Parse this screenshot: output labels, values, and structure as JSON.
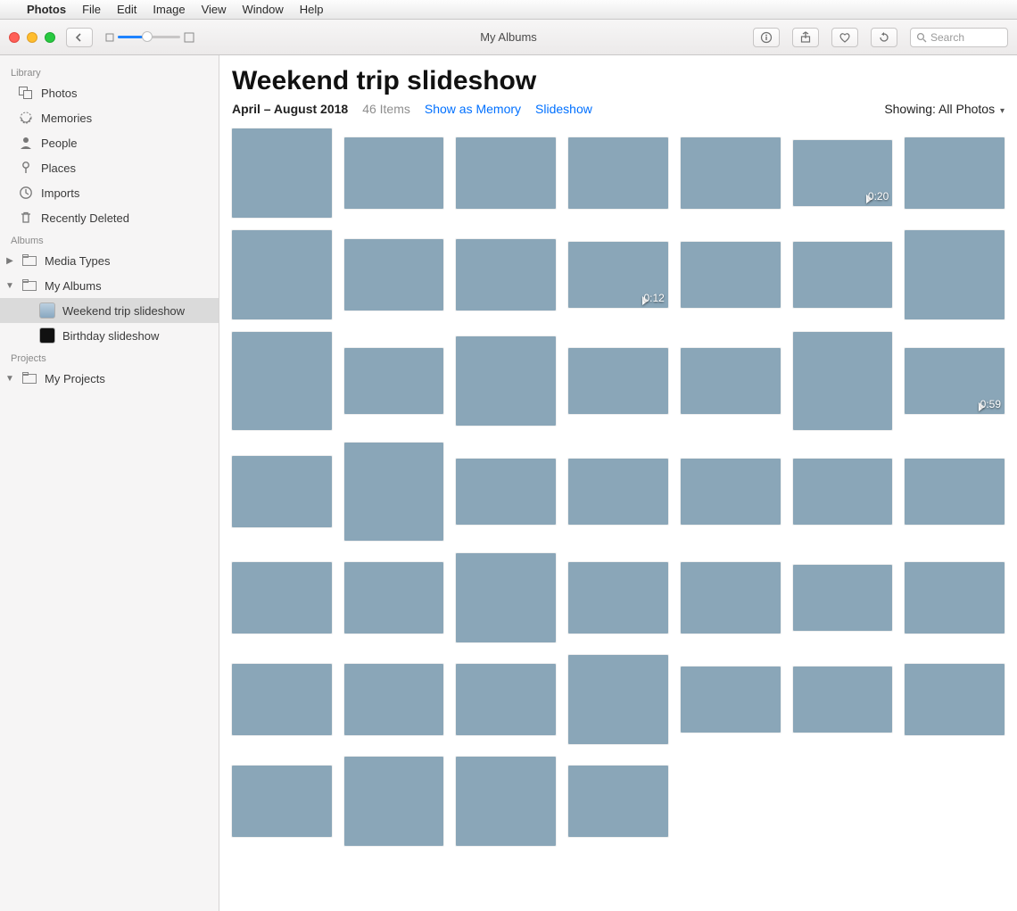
{
  "menubar": {
    "app": "Photos",
    "items": [
      "File",
      "Edit",
      "Image",
      "View",
      "Window",
      "Help"
    ]
  },
  "window": {
    "title": "My Albums"
  },
  "toolbar": {
    "search_placeholder": "Search"
  },
  "sidebar": {
    "sections": [
      {
        "label": "Library",
        "items": [
          {
            "name": "Photos",
            "icon": "photos-icon"
          },
          {
            "name": "Memories",
            "icon": "memories-icon"
          },
          {
            "name": "People",
            "icon": "people-icon"
          },
          {
            "name": "Places",
            "icon": "places-icon"
          },
          {
            "name": "Imports",
            "icon": "imports-icon"
          },
          {
            "name": "Recently Deleted",
            "icon": "trash-icon"
          }
        ]
      },
      {
        "label": "Albums",
        "items": [
          {
            "name": "Media Types",
            "icon": "folder-icon",
            "disclosure": "right"
          },
          {
            "name": "My Albums",
            "icon": "folder-icon",
            "disclosure": "down",
            "children": [
              {
                "name": "Weekend trip slideshow",
                "selected": true
              },
              {
                "name": "Birthday slideshow"
              }
            ]
          }
        ]
      },
      {
        "label": "Projects",
        "items": [
          {
            "name": "My Projects",
            "icon": "folder-icon",
            "disclosure": "down"
          }
        ]
      }
    ]
  },
  "main": {
    "title": "Weekend trip slideshow",
    "date_range": "April – August 2018",
    "count_label": "46 Items",
    "link_memory": "Show as Memory",
    "link_slideshow": "Slideshow",
    "showing_label": "Showing:",
    "showing_value": "All Photos",
    "thumbs": [
      {
        "cls": "plain",
        "h": "h100"
      },
      {
        "cls": "plain",
        "h": "h80"
      },
      {
        "cls": "road",
        "h": "h80"
      },
      {
        "cls": "warm",
        "h": "h80"
      },
      {
        "cls": "people",
        "h": "h80"
      },
      {
        "cls": "forest",
        "h": "h74",
        "video": "0:20"
      },
      {
        "cls": "sea",
        "h": "h80"
      },
      {
        "cls": "beach",
        "h": "h100"
      },
      {
        "cls": "beach",
        "h": "h80"
      },
      {
        "cls": "sea",
        "h": "h80"
      },
      {
        "cls": "dark",
        "h": "h74",
        "video": "0:12"
      },
      {
        "cls": "beach",
        "h": "h74"
      },
      {
        "cls": "sea",
        "h": "h74"
      },
      {
        "cls": "sea",
        "h": "h100"
      },
      {
        "cls": "sea",
        "h": "h110"
      },
      {
        "cls": "beach",
        "h": "h74"
      },
      {
        "cls": "sea",
        "h": "h100",
        "w": "w70"
      },
      {
        "cls": "sea",
        "h": "h74"
      },
      {
        "cls": "sea",
        "h": "h74"
      },
      {
        "cls": "people",
        "h": "h110",
        "w": "w85"
      },
      {
        "cls": "sunset",
        "h": "h74",
        "video": "0:59"
      },
      {
        "cls": "sunset",
        "h": "h80"
      },
      {
        "cls": "people",
        "h": "h110",
        "w": "w70"
      },
      {
        "cls": "sea",
        "h": "h74"
      },
      {
        "cls": "rock",
        "h": "h74"
      },
      {
        "cls": "rock",
        "h": "h74"
      },
      {
        "cls": "rock",
        "h": "h74"
      },
      {
        "cls": "rock",
        "h": "h74"
      },
      {
        "cls": "rock",
        "h": "h80"
      },
      {
        "cls": "rock",
        "h": "h80"
      },
      {
        "cls": "plain",
        "h": "h100",
        "w": "w70"
      },
      {
        "cls": "people",
        "h": "h80"
      },
      {
        "cls": "rock",
        "h": "h80"
      },
      {
        "cls": "warm",
        "h": "h74"
      },
      {
        "cls": "warm",
        "h": "h80"
      },
      {
        "cls": "forest",
        "h": "h80"
      },
      {
        "cls": "rock",
        "h": "h80"
      },
      {
        "cls": "rock",
        "h": "h80"
      },
      {
        "cls": "dark",
        "h": "h100",
        "w": "w85"
      },
      {
        "cls": "rock",
        "h": "h74"
      },
      {
        "cls": "dark",
        "h": "h74"
      },
      {
        "cls": "people",
        "h": "h80"
      },
      {
        "cls": "people",
        "h": "h80"
      },
      {
        "cls": "people",
        "h": "h100",
        "w": "w85"
      },
      {
        "cls": "people",
        "h": "h100",
        "w": "w85"
      },
      {
        "cls": "beach",
        "h": "h80"
      }
    ]
  }
}
